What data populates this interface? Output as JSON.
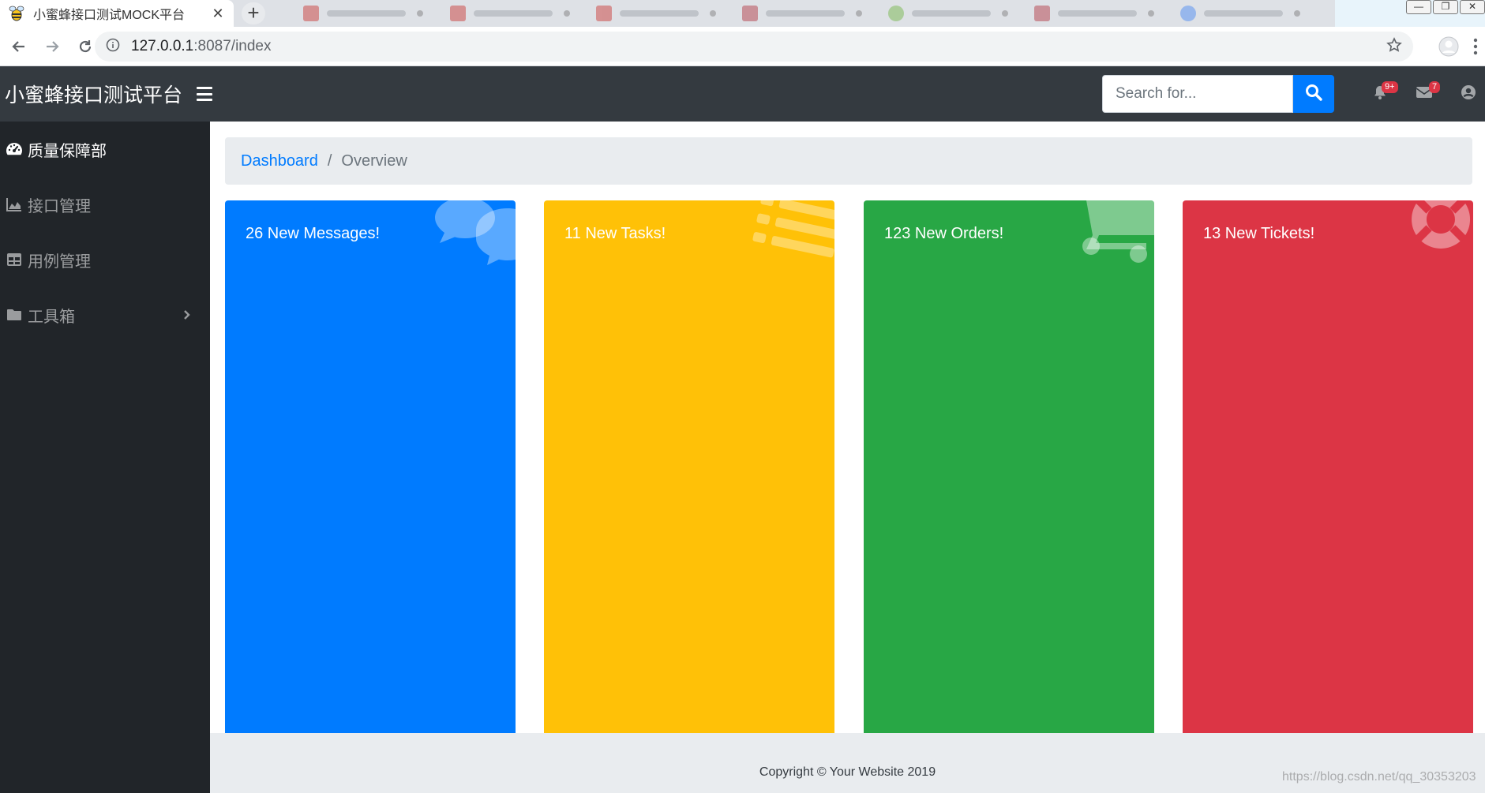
{
  "browser": {
    "active_tab_title": "小蜜蜂接口测试MOCK平台",
    "url_host": "127.0.0.1",
    "url_rest": ":8087/index"
  },
  "app": {
    "brand": "小蜜蜂接口测试平台",
    "search_placeholder": "Search for...",
    "alerts_badge": "9+",
    "messages_badge": "7"
  },
  "sidebar": {
    "items": [
      {
        "label": "质量保障部",
        "icon": "tachometer-icon",
        "active": true
      },
      {
        "label": "接口管理",
        "icon": "area-chart-icon",
        "active": false
      },
      {
        "label": "用例管理",
        "icon": "table-icon",
        "active": false
      },
      {
        "label": "工具箱",
        "icon": "folder-icon",
        "active": false,
        "has_submenu": true
      }
    ]
  },
  "breadcrumb": {
    "link": "Dashboard",
    "separator": "/",
    "current": "Overview"
  },
  "cards": [
    {
      "text": "26 New Messages!",
      "color": "#007bff",
      "icon": "comments-icon"
    },
    {
      "text": "11 New Tasks!",
      "color": "#ffc107",
      "icon": "list-icon"
    },
    {
      "text": "123 New Orders!",
      "color": "#28a745",
      "icon": "shopping-cart-icon"
    },
    {
      "text": "13 New Tickets!",
      "color": "#dc3545",
      "icon": "life-ring-icon"
    }
  ],
  "footer": {
    "copyright": "Copyright © Your Website 2019"
  },
  "watermark": "https://blog.csdn.net/qq_30353203"
}
